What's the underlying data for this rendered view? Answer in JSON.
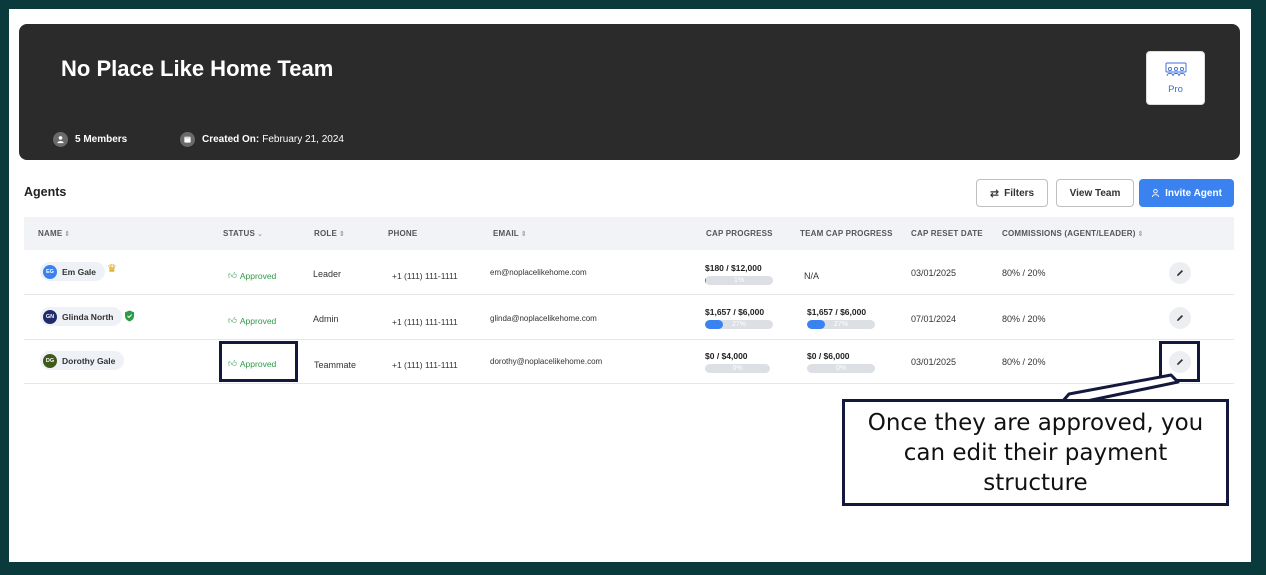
{
  "header": {
    "team_name": "No Place Like Home Team",
    "members": "5 Members",
    "created_label": "Created On:",
    "created_date": "February 21, 2024",
    "plan": "Pro"
  },
  "agents": {
    "title": "Agents",
    "filters_label": "Filters",
    "view_team_label": "View Team",
    "invite_label": "Invite Agent"
  },
  "columns": [
    "NAME",
    "STATUS",
    "ROLE",
    "PHONE",
    "EMAIL",
    "CAP PROGRESS",
    "TEAM CAP PROGRESS",
    "CAP RESET DATE",
    "COMMISSIONS (AGENT/LEADER)"
  ],
  "rows": [
    {
      "initials": "EG",
      "name": "Em Gale",
      "badge": "crown-icon",
      "avatar_color": "#3a82f0",
      "status": "Approved",
      "role": "Leader",
      "phone": "+1 (111) 111-1111",
      "email": "em@noplacelikehome.com",
      "cap": "$180 / $12,000",
      "cap_pct": "1%",
      "cap_fill": 1,
      "team_cap": "N/A",
      "team_cap_pct": "",
      "team_cap_fill": 0,
      "reset": "03/01/2025",
      "commission": "80% / 20%"
    },
    {
      "initials": "GN",
      "name": "Glinda North",
      "badge": "shield-icon",
      "avatar_color": "#1f2b6b",
      "status": "Approved",
      "role": "Admin",
      "phone": "+1 (111) 111-1111",
      "email": "glinda@noplacelikehome.com",
      "cap": "$1,657 / $6,000",
      "cap_pct": "27%",
      "cap_fill": 27,
      "team_cap": "$1,657 / $6,000",
      "team_cap_pct": "27%",
      "team_cap_fill": 27,
      "reset": "07/01/2024",
      "commission": "80% / 20%"
    },
    {
      "initials": "DG",
      "name": "Dorothy Gale",
      "badge": "",
      "avatar_color": "#3d5a1a",
      "status": "Approved",
      "role": "Teammate",
      "phone": "+1 (111) 111-1111",
      "email": "dorothy@noplacelikehome.com",
      "cap": "$0 / $4,000",
      "cap_pct": "0%",
      "cap_fill": 0,
      "team_cap": "$0 / $6,000",
      "team_cap_pct": "0%",
      "team_cap_fill": 0,
      "reset": "03/01/2025",
      "commission": "80% / 20%"
    }
  ],
  "callout": {
    "text": "Once they are approved, you can edit their payment structure"
  },
  "colors": {
    "header_bg": "#2b2b2b",
    "accent": "#3a82f0",
    "approved": "#2f9a48",
    "annotation": "#14183d"
  }
}
